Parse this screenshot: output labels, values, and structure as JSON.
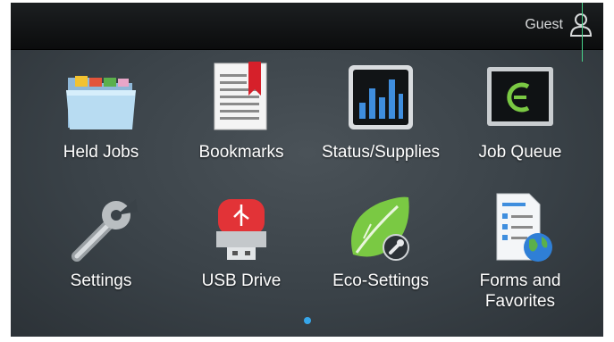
{
  "header": {
    "user_label": "Guest"
  },
  "apps": [
    {
      "label": "Held Jobs",
      "icon": "folder-icon"
    },
    {
      "label": "Bookmarks",
      "icon": "bookmark-document-icon"
    },
    {
      "label": "Status/Supplies",
      "icon": "bar-chart-icon"
    },
    {
      "label": "Job Queue",
      "icon": "monitor-icon"
    },
    {
      "label": "Settings",
      "icon": "wrench-icon"
    },
    {
      "label": "USB Drive",
      "icon": "usb-drive-icon"
    },
    {
      "label": "Eco-Settings",
      "icon": "leaf-icon"
    },
    {
      "label": "Forms and Favorites",
      "icon": "form-globe-icon"
    }
  ],
  "pager": {
    "current_page": 1
  },
  "colors": {
    "accent": "#36a6ea",
    "eco_green": "#7ac943",
    "bookmark_red": "#d6202a"
  }
}
